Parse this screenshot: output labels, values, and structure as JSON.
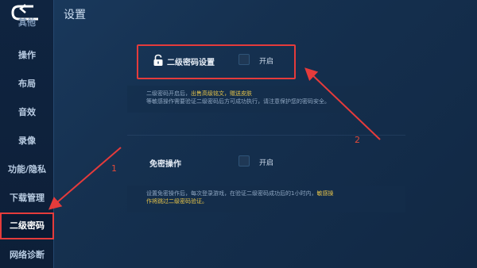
{
  "header": {
    "title": "设置"
  },
  "sidebar": {
    "partial_item": "其他",
    "items": [
      {
        "label": "操作"
      },
      {
        "label": "布局"
      },
      {
        "label": "音效"
      },
      {
        "label": "录像"
      },
      {
        "label": "功能/隐私"
      },
      {
        "label": "下载管理"
      },
      {
        "label": "二级密码"
      },
      {
        "label": "网络诊断"
      }
    ],
    "active_index": 6
  },
  "secondary_password": {
    "label": "二级密码设置",
    "toggle_label": "开启",
    "checked": false,
    "desc_line1_prefix": "二级密码开启后，",
    "desc_line1_highlight": "出售高级铭文，赠送皮肤",
    "desc_line2": "等敏感操作需要验证二级密码后方可成功执行，请注意保护您的密码安全。"
  },
  "password_free": {
    "label": "免密操作",
    "toggle_label": "开启",
    "checked": false,
    "desc_line1_prefix": "设置免密操作后，每次登录游戏，在验证二级密码成功后的1小时内，",
    "desc_line1_highlight": "敏感操",
    "desc_line2_highlight": "作将跳过二级密码验证。"
  },
  "annotations": {
    "arrow1": "1",
    "arrow2": "2"
  },
  "colors": {
    "highlight_red": "#e53b3b",
    "warning_yellow": "#e6c44a",
    "background": "#15304f"
  }
}
